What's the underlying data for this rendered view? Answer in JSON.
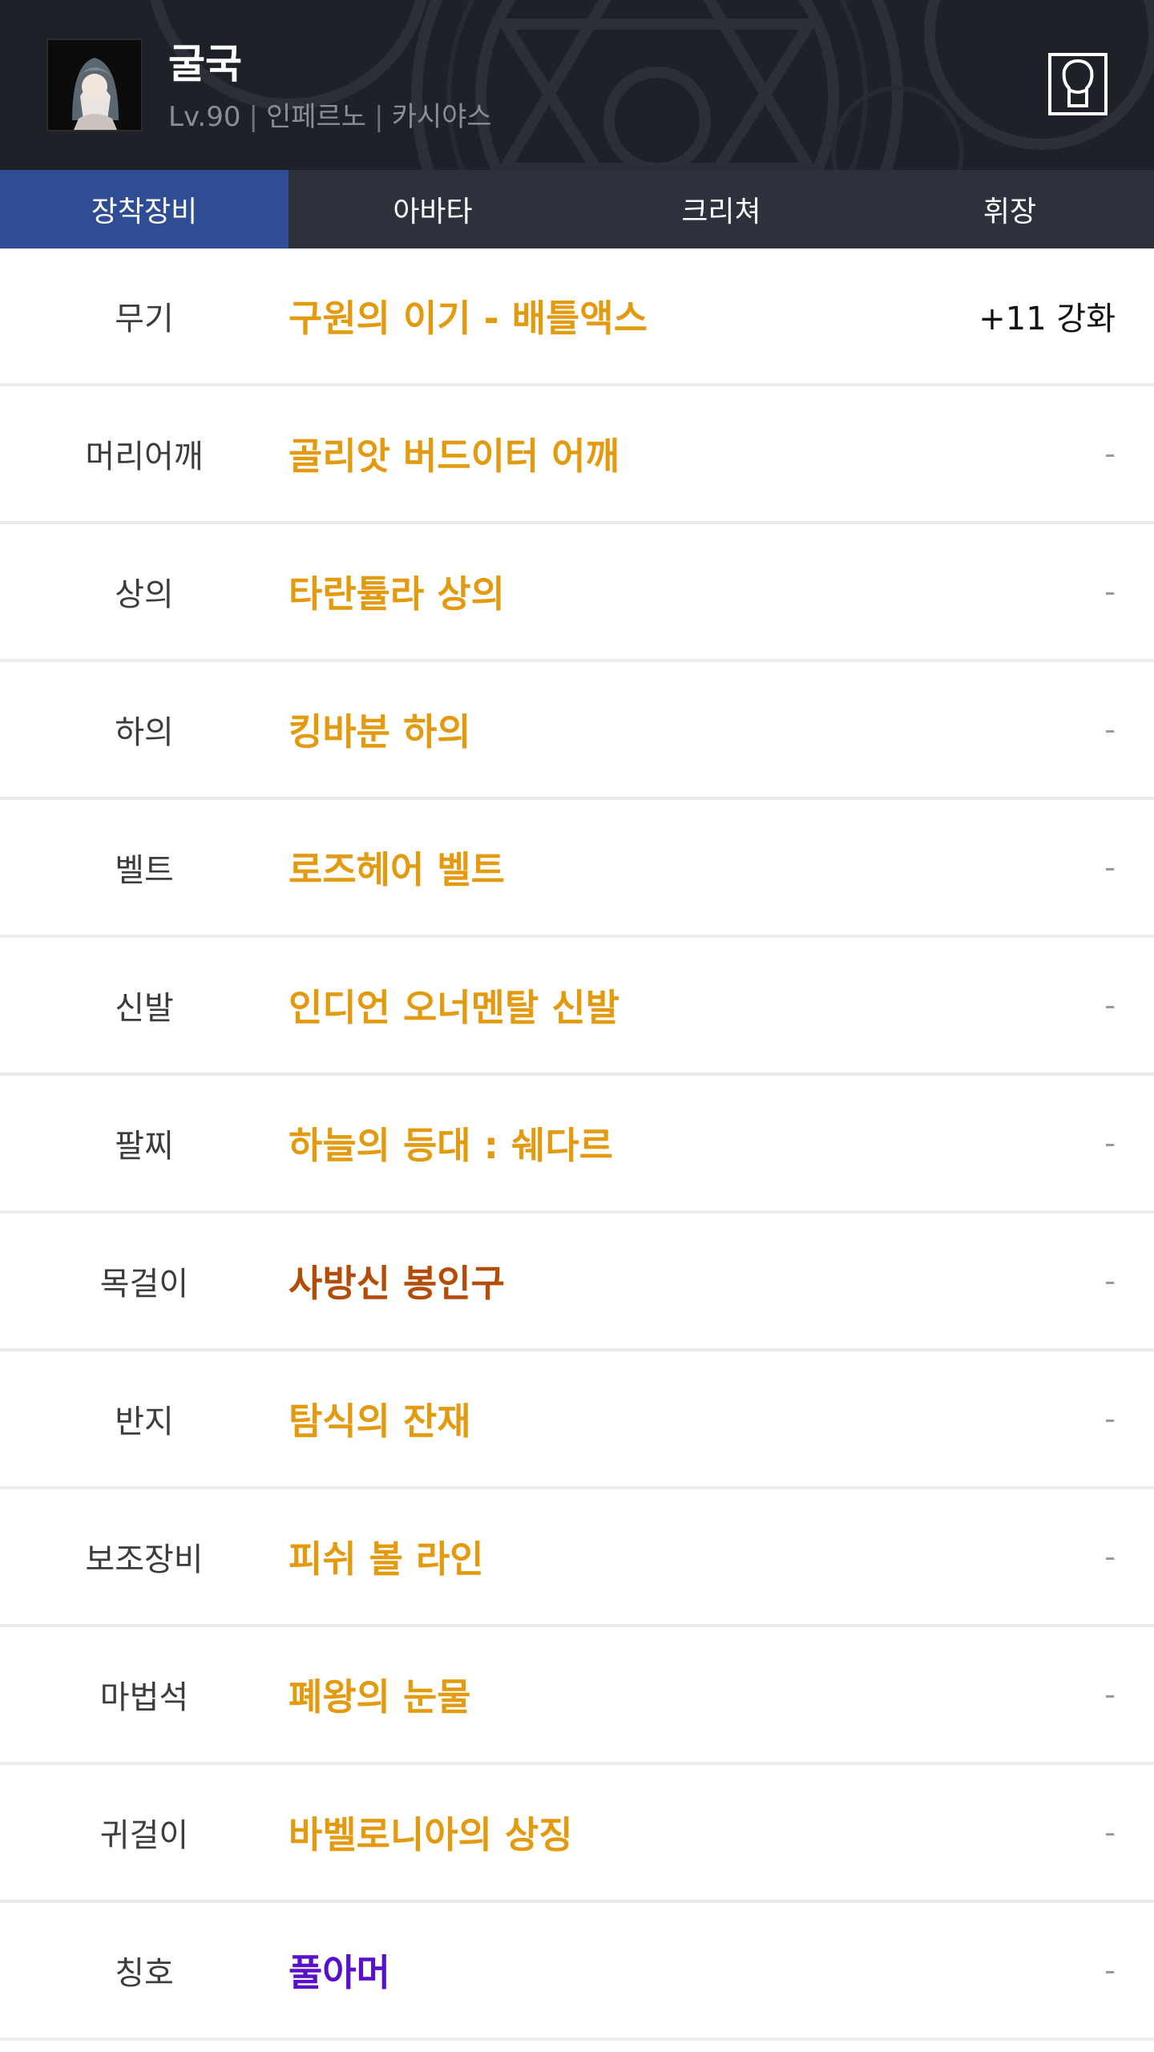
{
  "character": {
    "name": "굴국",
    "level": "Lv.90",
    "job": "인페르노",
    "server": "카시야스",
    "avatar_icon": "character-portrait-icon"
  },
  "header": {
    "profile_icon": "user-profile-icon"
  },
  "tabs": [
    {
      "label": "장착장비",
      "active": true
    },
    {
      "label": "아바타",
      "active": false
    },
    {
      "label": "크리쳐",
      "active": false
    },
    {
      "label": "휘장",
      "active": false
    }
  ],
  "colors": {
    "epic": "#e39a0e",
    "unique": "#b34c07",
    "rare": "#5a10c8",
    "active_tab": "#2f4d94"
  },
  "equipment": [
    {
      "slot": "무기",
      "item": "구원의 이기 - 배틀액스",
      "extra": "+11 강화",
      "rarity": "epic"
    },
    {
      "slot": "머리어깨",
      "item": "골리앗 버드이터 어깨",
      "extra": "-",
      "rarity": "epic"
    },
    {
      "slot": "상의",
      "item": "타란튤라 상의",
      "extra": "-",
      "rarity": "epic"
    },
    {
      "slot": "하의",
      "item": "킹바분 하의",
      "extra": "-",
      "rarity": "epic"
    },
    {
      "slot": "벨트",
      "item": "로즈헤어 벨트",
      "extra": "-",
      "rarity": "epic"
    },
    {
      "slot": "신발",
      "item": "인디언 오너멘탈 신발",
      "extra": "-",
      "rarity": "epic"
    },
    {
      "slot": "팔찌",
      "item": "하늘의 등대 : 쉐다르",
      "extra": "-",
      "rarity": "epic"
    },
    {
      "slot": "목걸이",
      "item": "사방신 봉인구",
      "extra": "-",
      "rarity": "unique"
    },
    {
      "slot": "반지",
      "item": "탐식의 잔재",
      "extra": "-",
      "rarity": "epic"
    },
    {
      "slot": "보조장비",
      "item": "피쉬 볼 라인",
      "extra": "-",
      "rarity": "epic"
    },
    {
      "slot": "마법석",
      "item": "폐왕의 눈물",
      "extra": "-",
      "rarity": "epic"
    },
    {
      "slot": "귀걸이",
      "item": "바벨로니아의 상징",
      "extra": "-",
      "rarity": "epic"
    },
    {
      "slot": "칭호",
      "item": "풀아머",
      "extra": "-",
      "rarity": "rare"
    }
  ]
}
